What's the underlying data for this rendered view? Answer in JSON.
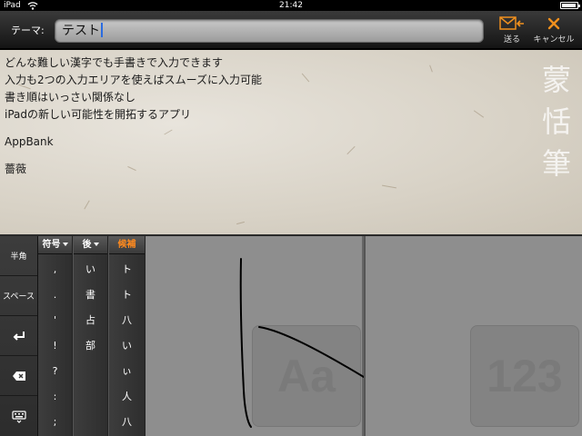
{
  "status": {
    "carrier": "iPad",
    "time": "21:42",
    "battery_level": 0.95
  },
  "toolbar": {
    "theme_label": "テーマ:",
    "theme_value": "テスト",
    "send_label": "送る",
    "cancel_label": "キャンセル",
    "icons": {
      "send": "envelope-send-icon",
      "cancel": "x-cancel-icon"
    },
    "accent_color": "#f0901e"
  },
  "memo": {
    "lines": [
      "どんな難しい漢字でも手書きで入力できます",
      "入力も2つの入力エリアを使えばスムーズに入力可能",
      "書き順はいっさい関係なし",
      "iPadの新しい可能性を開拓するアプリ",
      "",
      "AppBank",
      "",
      "薔薇"
    ],
    "brand_vertical": [
      "蒙",
      "恬",
      "筆"
    ]
  },
  "keyboard": {
    "side_keys": {
      "hankaku": "半角",
      "space": "スペース",
      "icons": [
        "return-icon",
        "delete-icon",
        "keyboard-hide-icon"
      ]
    },
    "columns": [
      {
        "header": "符号",
        "dropdown": true,
        "items": [
          ",",
          ".",
          "'",
          "!",
          "?",
          ":",
          ";"
        ]
      },
      {
        "header": "後",
        "dropdown": true,
        "items": [
          "い",
          "書",
          "占",
          "部"
        ]
      },
      {
        "header": "候補",
        "dropdown": false,
        "items": [
          "ト",
          "ト",
          "八",
          "い",
          "ぃ",
          "人",
          "八"
        ]
      }
    ],
    "write_area_a": {
      "mode_label": "Aa"
    },
    "write_area_b": {
      "mode_label": "123"
    }
  }
}
